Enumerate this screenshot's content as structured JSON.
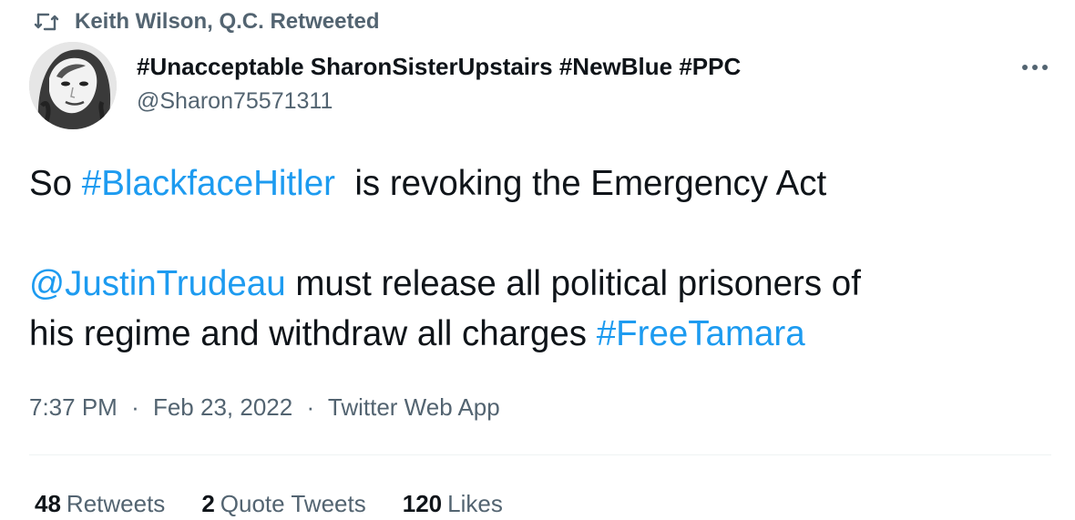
{
  "retweet": {
    "icon": "retweet-icon",
    "text": "Keith Wilson, Q.C. Retweeted"
  },
  "author": {
    "avatar_icon": "profile-photo",
    "display_name": "#Unacceptable SharonSisterUpstairs #NewBlue #PPC",
    "handle": "@Sharon75571311"
  },
  "more_icon": "ellipsis-icon",
  "tweet": {
    "line1_pre": "So ",
    "hashtag1": "#BlackfaceHitler",
    "line1_post": "  is revoking the Emergency Act",
    "mention": "@JustinTrudeau",
    "line3_post": " must release all political prisoners of",
    "line4_pre": "his regime and withdraw all charges ",
    "hashtag2": "#FreeTamara"
  },
  "meta": {
    "time": "7:37 PM",
    "date": "Feb 23, 2022",
    "source": "Twitter Web App",
    "separator": "·"
  },
  "stats": {
    "retweets_count": "48",
    "retweets_label": "Retweets",
    "quotes_count": "2",
    "quotes_label": "Quote Tweets",
    "likes_count": "120",
    "likes_label": "Likes"
  },
  "colors": {
    "link": "#1d9bf0",
    "secondary_text": "#536471",
    "primary_text": "#0f1419"
  }
}
